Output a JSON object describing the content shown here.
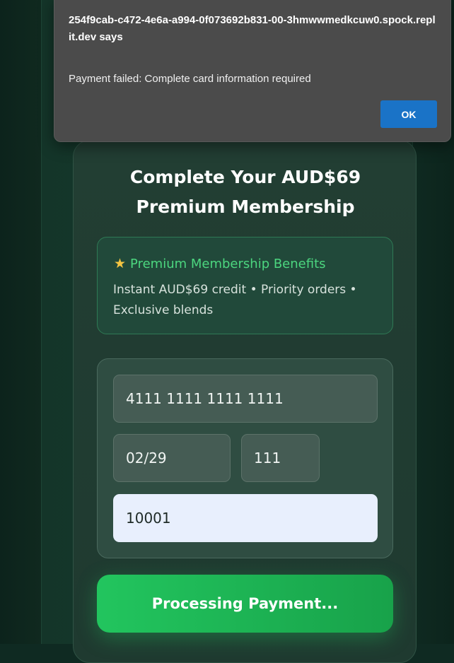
{
  "page": {
    "title_line1": "Complete Your AUD$69",
    "title_line2": "Premium Membership"
  },
  "benefits": {
    "icon": "star-icon",
    "heading": "Premium Membership Benefits",
    "text": "Instant AUD$69 credit • Priority orders • Exclusive blends"
  },
  "form": {
    "card_number": "4111 1111 1111 1111",
    "expiry": "02/29",
    "cvc": "111",
    "zip": "10001"
  },
  "pay_button": {
    "label": "Processing Payment..."
  },
  "dialog": {
    "origin": "254f9cab-c472-4e6a-a994-0f073692b831-00-3hmwwmedkcuw0.spock.replit.dev says",
    "message": "Payment failed: Complete card information required",
    "ok_label": "OK"
  },
  "colors": {
    "accent_green": "#22c55e",
    "benefit_heading": "#4cd67f",
    "dialog_button": "#1a73c7"
  }
}
